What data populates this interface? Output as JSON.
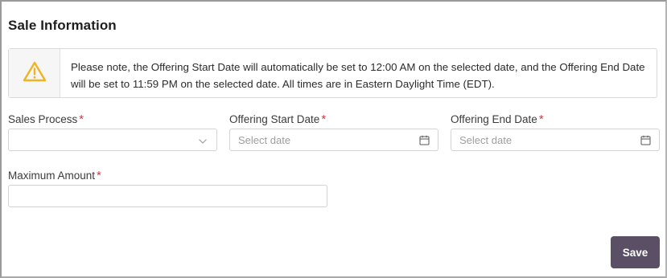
{
  "section": {
    "title": "Sale Information"
  },
  "notice": {
    "icon": "warning-icon",
    "text": "Please note, the Offering Start Date will automatically be set to 12:00 AM on the selected date, and the Offering End Date will be set to 11:59 PM on the selected date. All times are in Eastern Daylight Time (EDT)."
  },
  "form": {
    "sales_process": {
      "label": "Sales Process",
      "required_mark": "*",
      "value": ""
    },
    "offering_start_date": {
      "label": "Offering Start Date",
      "required_mark": "*",
      "placeholder": "Select date"
    },
    "offering_end_date": {
      "label": "Offering End Date",
      "required_mark": "*",
      "placeholder": "Select date"
    },
    "maximum_amount": {
      "label": "Maximum Amount",
      "required_mark": "*",
      "value": ""
    }
  },
  "actions": {
    "save_label": "Save"
  },
  "colors": {
    "accent": "#5b4f66",
    "required": "#e0313c",
    "warning": "#f0b323"
  }
}
